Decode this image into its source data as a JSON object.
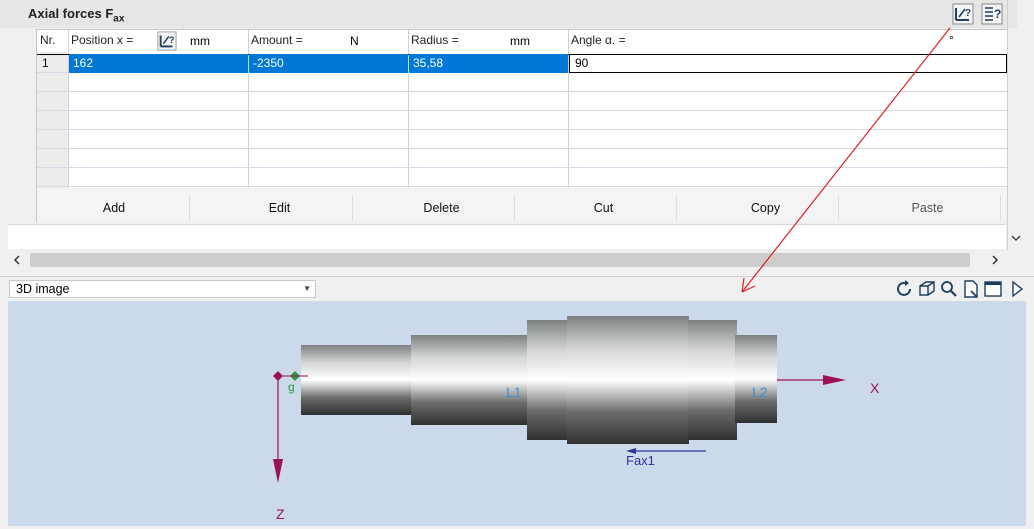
{
  "panel": {
    "title_main": "Axial forces F",
    "title_sub": "ax",
    "columns": [
      {
        "label": "Nr.",
        "unit": ""
      },
      {
        "label": "Position x =",
        "unit": "mm"
      },
      {
        "label": "Amount =",
        "unit": "N"
      },
      {
        "label": "Radius =",
        "unit": "mm"
      },
      {
        "label": "Angle α. =",
        "unit": "°"
      }
    ],
    "rows": [
      {
        "nr": "1",
        "position": "162",
        "amount": "-2350",
        "radius": "35,58",
        "angle": "90"
      }
    ],
    "buttons": [
      "Add",
      "Edit",
      "Delete",
      "Cut",
      "Copy",
      "Paste"
    ]
  },
  "view": {
    "select_value": "3D image",
    "labels": {
      "x_axis": "X",
      "z_axis": "Z",
      "gravity": "g",
      "l1": "L1",
      "l2": "L2",
      "force": "Fax1"
    }
  },
  "colors": {
    "selection": "#0078d7",
    "view_background": "#ccd9ea",
    "axis": "#9b1257",
    "force": "#2a35a0",
    "dimension_label": "#3f8ed8",
    "annotation_arrow": "#e02020"
  }
}
